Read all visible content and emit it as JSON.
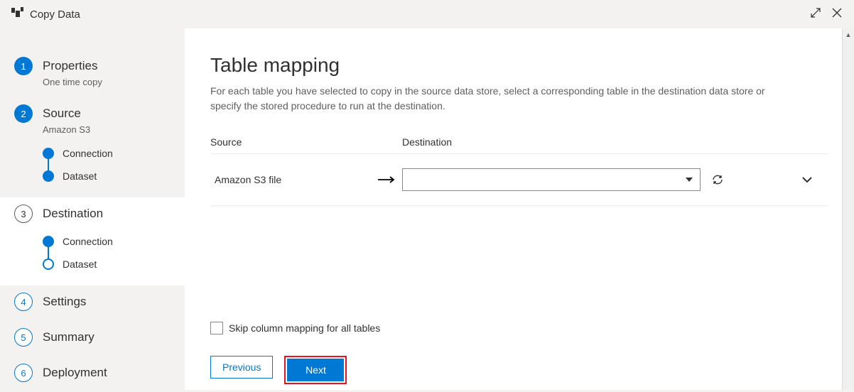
{
  "header": {
    "title": "Copy Data"
  },
  "sidebar": {
    "steps": [
      {
        "num": "1",
        "title": "Properties",
        "sub": "One time copy"
      },
      {
        "num": "2",
        "title": "Source",
        "sub": "Amazon S3",
        "substeps": [
          {
            "label": "Connection"
          },
          {
            "label": "Dataset"
          }
        ]
      },
      {
        "num": "3",
        "title": "Destination",
        "substeps": [
          {
            "label": "Connection"
          },
          {
            "label": "Dataset"
          }
        ]
      },
      {
        "num": "4",
        "title": "Settings"
      },
      {
        "num": "5",
        "title": "Summary"
      },
      {
        "num": "6",
        "title": "Deployment"
      }
    ]
  },
  "content": {
    "title": "Table mapping",
    "description": "For each table you have selected to copy in the source data store, select a corresponding table in the destination data store or specify the stored procedure to run at the destination.",
    "columns": {
      "source": "Source",
      "destination": "Destination"
    },
    "rows": [
      {
        "source": "Amazon S3 file",
        "destination": ""
      }
    ],
    "skip_label": "Skip column mapping for all tables",
    "buttons": {
      "previous": "Previous",
      "next": "Next"
    }
  }
}
